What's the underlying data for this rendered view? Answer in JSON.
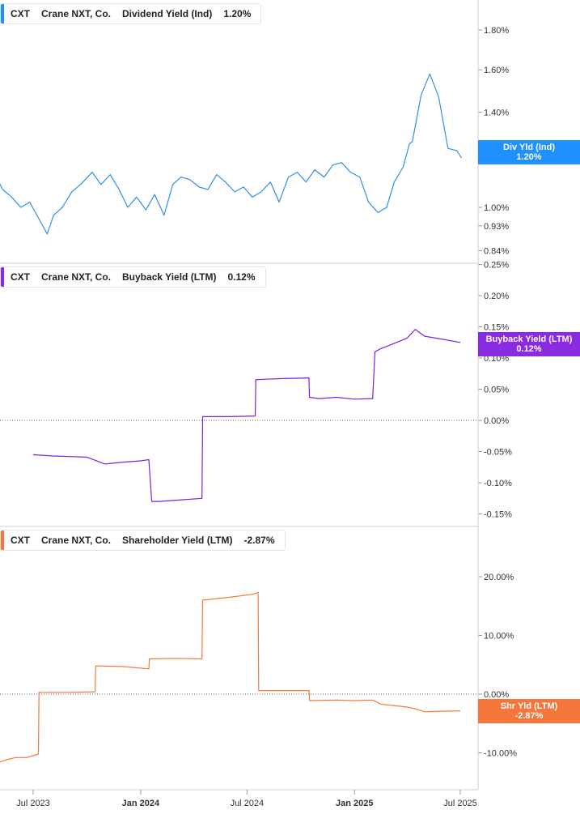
{
  "panels": [
    {
      "id": "dividend",
      "ticker": "CXT",
      "company": "Crane NXT, Co.",
      "metric": "Dividend Yield (Ind)",
      "value": "1.20%",
      "tag_title": "Div Yld (Ind)",
      "tag_value": "1.20%",
      "color": "#2f8fe6",
      "tag_color": "#1e90ff",
      "ticks": [
        "1.80%",
        "1.60%",
        "1.40%",
        "1.00%",
        "0.93%",
        "0.84%"
      ],
      "tick_values": [
        1.8,
        1.6,
        1.4,
        1.0,
        0.93,
        0.84
      ],
      "zero_line": false
    },
    {
      "id": "buyback",
      "ticker": "CXT",
      "company": "Crane NXT, Co.",
      "metric": "Buyback Yield (LTM)",
      "value": "0.12%",
      "tag_title": "Buyback Yield (LTM)",
      "tag_value": "0.12%",
      "color": "#7b1fe0",
      "tag_color": "#8a2be2",
      "ticks": [
        "0.25%",
        "0.20%",
        "0.15%",
        "0.10%",
        "0.05%",
        "0.00%",
        "-0.05%",
        "-0.10%",
        "-0.15%"
      ],
      "tick_values": [
        0.25,
        0.2,
        0.15,
        0.1,
        0.05,
        0.0,
        -0.05,
        -0.1,
        -0.15
      ],
      "zero_line": true
    },
    {
      "id": "shareholder",
      "ticker": "CXT",
      "company": "Crane NXT, Co.",
      "metric": "Shareholder Yield (LTM)",
      "value": "-2.87%",
      "tag_title": "Shr Yld (LTM)",
      "tag_value": "-2.87%",
      "color": "#f07a3a",
      "tag_color": "#f5763a",
      "ticks": [
        "20.00%",
        "10.00%",
        "0.00%",
        "-10.00%"
      ],
      "tick_values": [
        20,
        10,
        0,
        -10
      ],
      "zero_line": true
    }
  ],
  "x_axis": {
    "ticks": [
      {
        "label": "Jul 2023",
        "date": "2023-07-01",
        "bold": false
      },
      {
        "label": "Jan 2024",
        "date": "2024-01-01",
        "bold": true
      },
      {
        "label": "Jul 2024",
        "date": "2024-07-01",
        "bold": false
      },
      {
        "label": "Jan 2025",
        "date": "2025-01-01",
        "bold": true
      },
      {
        "label": "Jul 2025",
        "date": "2025-07-01",
        "bold": false
      }
    ]
  },
  "chart_data": [
    {
      "type": "line",
      "title": "",
      "series": [
        {
          "name": "Dividend Yield (Ind)",
          "x": [
            "2023-04-24",
            "2023-05-10",
            "2023-05-25",
            "2023-06-10",
            "2023-06-25",
            "2023-07-10",
            "2023-07-25",
            "2023-08-05",
            "2023-08-20",
            "2023-09-05",
            "2023-09-20",
            "2023-10-10",
            "2023-10-25",
            "2023-11-10",
            "2023-11-25",
            "2023-12-10",
            "2023-12-25",
            "2024-01-10",
            "2024-01-25",
            "2024-02-10",
            "2024-02-25",
            "2024-03-10",
            "2024-03-25",
            "2024-04-10",
            "2024-04-25",
            "2024-05-10",
            "2024-05-25",
            "2024-06-10",
            "2024-06-25",
            "2024-07-10",
            "2024-07-25",
            "2024-08-10",
            "2024-08-25",
            "2024-09-10",
            "2024-09-25",
            "2024-10-10",
            "2024-10-25",
            "2024-11-10",
            "2024-11-25",
            "2024-12-10",
            "2024-12-25",
            "2025-01-10",
            "2025-01-25",
            "2025-02-10",
            "2025-02-25",
            "2025-03-10",
            "2025-03-25",
            "2025-04-05",
            "2025-04-10",
            "2025-04-25",
            "2025-05-10",
            "2025-05-25",
            "2025-06-10",
            "2025-06-25",
            "2025-07-03"
          ],
          "values": [
            1.14,
            1.07,
            1.04,
            1.0,
            1.02,
            0.96,
            0.9,
            0.97,
            1.0,
            1.06,
            1.09,
            1.14,
            1.09,
            1.13,
            1.07,
            1.0,
            1.04,
            0.99,
            1.05,
            0.97,
            1.09,
            1.12,
            1.11,
            1.08,
            1.07,
            1.13,
            1.1,
            1.06,
            1.08,
            1.04,
            1.06,
            1.1,
            1.02,
            1.12,
            1.14,
            1.1,
            1.15,
            1.12,
            1.17,
            1.18,
            1.14,
            1.12,
            1.02,
            0.98,
            1.0,
            1.1,
            1.16,
            1.26,
            1.27,
            1.48,
            1.58,
            1.47,
            1.24,
            1.23,
            1.2
          ]
        }
      ]
    },
    {
      "type": "line",
      "title": "",
      "series": [
        {
          "name": "Buyback Yield (LTM)",
          "x": [
            "2023-07-01",
            "2023-08-01",
            "2023-09-01",
            "2023-10-01",
            "2023-11-01",
            "2023-12-01",
            "2024-01-01",
            "2024-01-15",
            "2024-01-20",
            "2024-02-01",
            "2024-03-01",
            "2024-04-15",
            "2024-04-16",
            "2024-05-01",
            "2024-06-01",
            "2024-07-15",
            "2024-07-16",
            "2024-08-01",
            "2024-09-01",
            "2024-10-15",
            "2024-10-16",
            "2024-11-01",
            "2024-12-01",
            "2025-01-01",
            "2025-02-01",
            "2025-02-05",
            "2025-02-15",
            "2025-03-01",
            "2025-04-01",
            "2025-04-15",
            "2025-05-01",
            "2025-06-01",
            "2025-07-01"
          ],
          "values": [
            -0.055,
            -0.057,
            -0.058,
            -0.059,
            -0.07,
            -0.067,
            -0.065,
            -0.063,
            -0.13,
            -0.13,
            -0.128,
            -0.125,
            0.006,
            0.006,
            0.006,
            0.007,
            0.065,
            0.066,
            0.067,
            0.068,
            0.037,
            0.035,
            0.037,
            0.034,
            0.035,
            0.11,
            0.115,
            0.12,
            0.132,
            0.146,
            0.135,
            0.13,
            0.125
          ]
        }
      ]
    },
    {
      "type": "line",
      "title": "",
      "series": [
        {
          "name": "Shareholder Yield (LTM)",
          "x": [
            "2023-04-24",
            "2023-05-15",
            "2023-06-01",
            "2023-06-20",
            "2023-07-10",
            "2023-07-11",
            "2023-09-01",
            "2023-10-15",
            "2023-10-16",
            "2023-12-01",
            "2024-01-15",
            "2024-01-16",
            "2024-03-01",
            "2024-04-15",
            "2024-04-16",
            "2024-06-01",
            "2024-07-10",
            "2024-07-20",
            "2024-07-21",
            "2024-09-01",
            "2024-10-15",
            "2024-10-16",
            "2024-12-01",
            "2025-01-01",
            "2025-02-01",
            "2025-02-15",
            "2025-04-01",
            "2025-04-15",
            "2025-05-01",
            "2025-06-01",
            "2025-07-01"
          ],
          "values": [
            -12.0,
            -11.2,
            -10.8,
            -10.8,
            -10.2,
            0.3,
            0.3,
            0.4,
            4.8,
            4.7,
            4.3,
            6.0,
            6.1,
            6.0,
            16.0,
            16.5,
            17.0,
            17.3,
            0.6,
            0.6,
            0.6,
            -1.1,
            -1.0,
            -1.1,
            -1.0,
            -1.7,
            -2.2,
            -2.5,
            -3.0,
            -2.9,
            -2.87
          ]
        }
      ]
    }
  ]
}
